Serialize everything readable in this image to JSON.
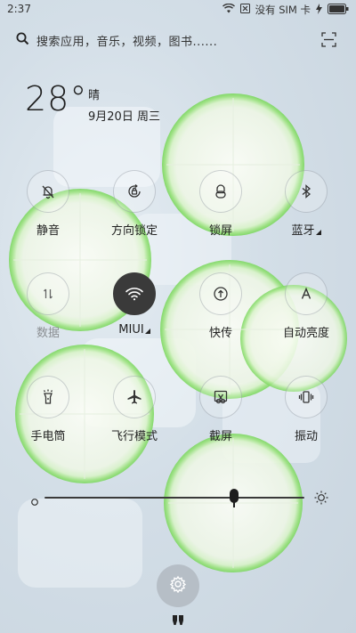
{
  "status_bar": {
    "time": "2:37",
    "sim_text": "没有 SIM 卡"
  },
  "search": {
    "placeholder": "搜索应用，音乐，视频，图书......"
  },
  "weather": {
    "temperature": "28°",
    "condition": "晴",
    "date": "9月20日 周三"
  },
  "toggles": [
    {
      "label": "静音",
      "icon": "bell-off-icon",
      "active": false
    },
    {
      "label": "方向锁定",
      "icon": "rotation-lock-icon",
      "active": false
    },
    {
      "label": "锁屏",
      "icon": "lock-icon",
      "active": false
    },
    {
      "label": "蓝牙",
      "icon": "bluetooth-icon",
      "active": false
    },
    {
      "label": "数据",
      "icon": "mobile-data-icon",
      "active": false,
      "dimmed": true
    },
    {
      "label": "MIUI",
      "icon": "wifi-icon",
      "active": true
    },
    {
      "label": "快传",
      "icon": "share-upload-icon",
      "active": false
    },
    {
      "label": "自动亮度",
      "icon": "auto-brightness-icon",
      "active": false
    },
    {
      "label": "手电筒",
      "icon": "flashlight-icon",
      "active": false
    },
    {
      "label": "飞行模式",
      "icon": "airplane-icon",
      "active": false
    },
    {
      "label": "截屏",
      "icon": "screenshot-scissors-icon",
      "active": false
    },
    {
      "label": "振动",
      "icon": "vibrate-icon",
      "active": false
    }
  ],
  "brightness": {
    "level": 0.73,
    "low_icon": "brightness-low-icon",
    "high_icon": "brightness-high-icon"
  },
  "bottom": {
    "settings_icon": "gear-icon",
    "handle_icon": "drag-handle-icon"
  }
}
